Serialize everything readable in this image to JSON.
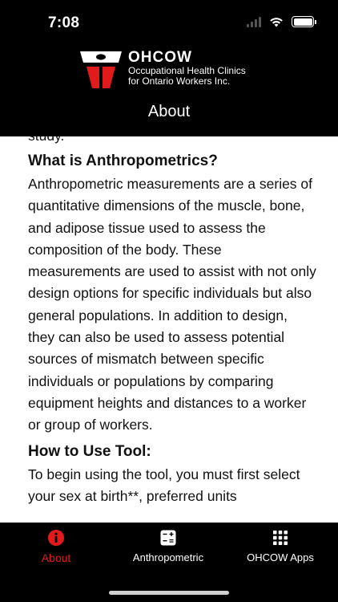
{
  "status_bar": {
    "time": "7:08"
  },
  "header": {
    "brand": "OHCOW",
    "subtitle_line1": "Occupational Health Clinics",
    "subtitle_line2": "for Ontario Workers Inc.",
    "page_title": "About"
  },
  "content": {
    "clipped_text": "study.",
    "sections": [
      {
        "heading": "What is Anthropometrics?",
        "text": "Anthropometric measurements are a series of quantitative dimensions of the muscle, bone, and adipose tissue used to assess the composition of the body. These measurements are used to assist with not only design options for specific individuals but also general populations. In addition to design, they can also be used to assess potential sources of mismatch between specific individuals or populations by comparing equipment heights and distances to a worker or group of workers."
      },
      {
        "heading": "How to Use Tool:",
        "text": "To begin using the tool, you must first select your sex at birth**, preferred units"
      }
    ]
  },
  "tabs": [
    {
      "label": "About",
      "icon": "info-icon",
      "active": true
    },
    {
      "label": "Anthropometric",
      "icon": "calculator-icon",
      "active": false
    },
    {
      "label": "OHCOW Apps",
      "icon": "grid-icon",
      "active": false
    }
  ],
  "colors": {
    "accent": "#e11b1b",
    "header_bg": "#000000",
    "content_bg": "#ffffff"
  }
}
